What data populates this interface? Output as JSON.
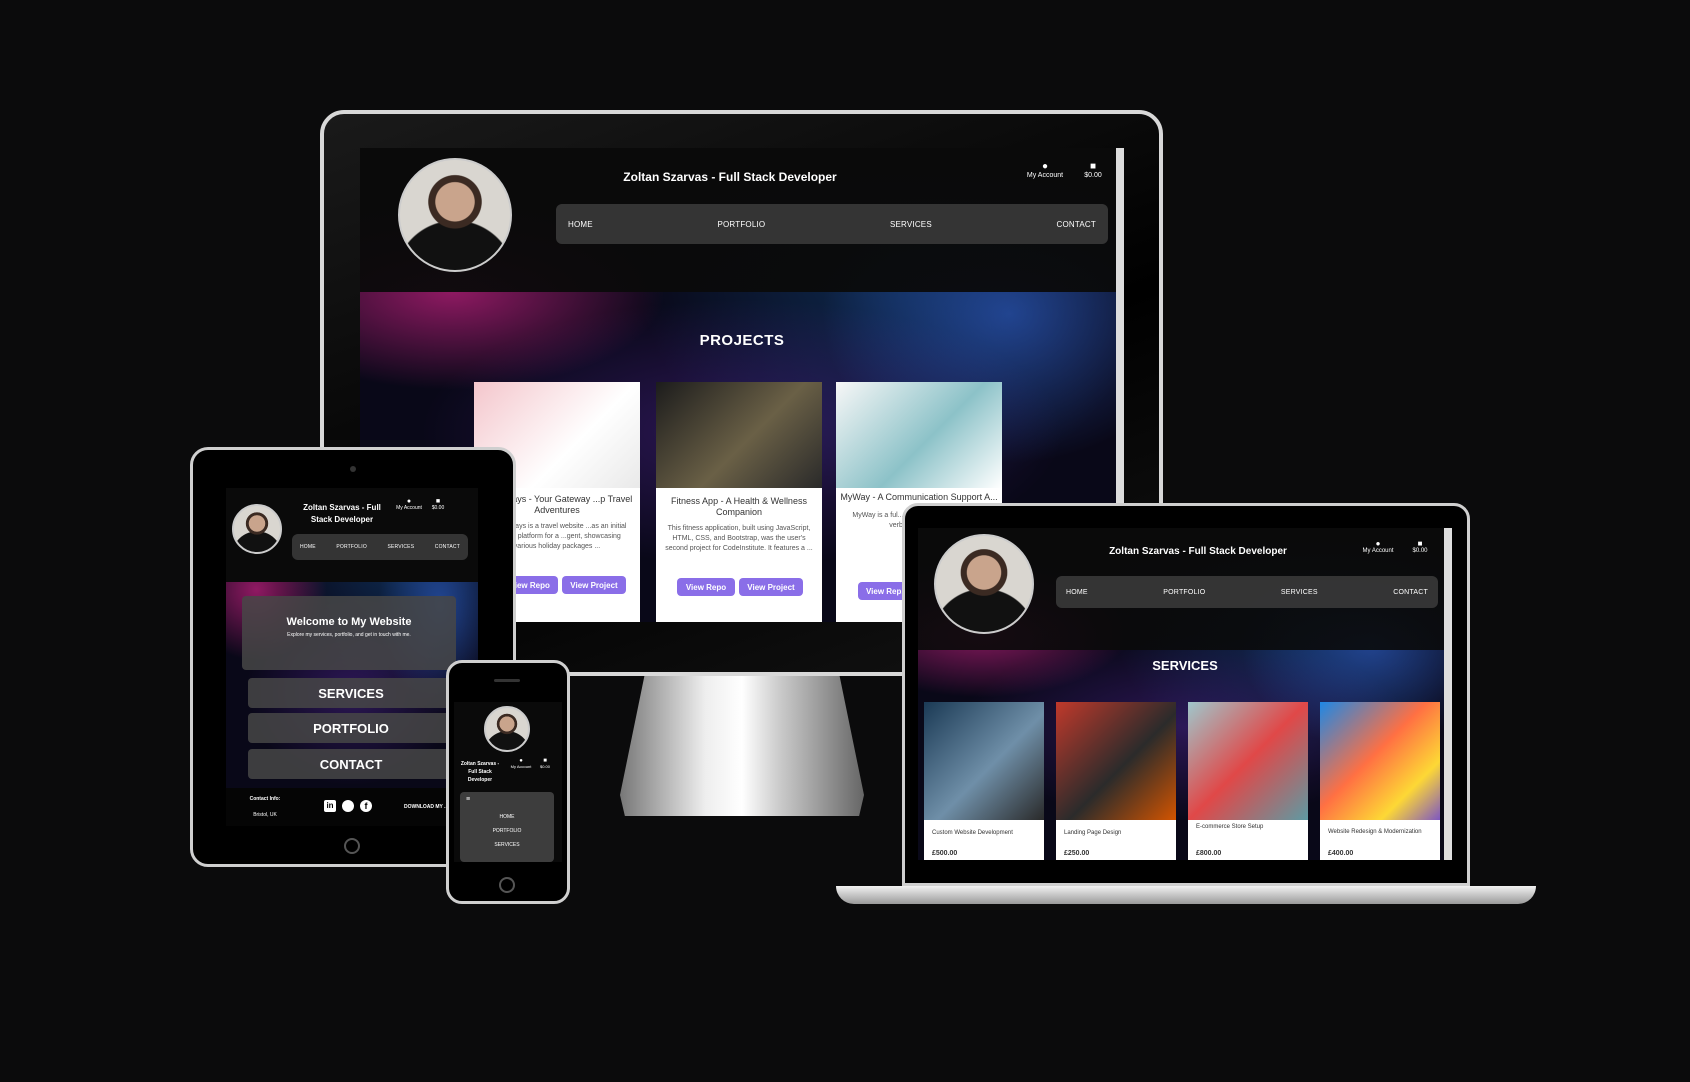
{
  "desktop": {
    "site_title": "Zoltan Szarvas - Full Stack Developer",
    "account_label": "My Account",
    "cart_total": "$0.00",
    "nav": [
      "HOME",
      "PORTFOLIO",
      "SERVICES",
      "CONTACT"
    ],
    "section_title": "PROJECTS",
    "projects": [
      {
        "title": "... Holidays - Your Gateway ...p Travel Adventures",
        "desc": "...o Holidays is a travel website ...as an initial contact platform for a ...gent, showcasing various holiday packages ...",
        "repo": "...iew Repo",
        "view": "View Project"
      },
      {
        "title": "Fitness App - A Health & Wellness Companion",
        "desc": "This fitness application, built using JavaScript, HTML, CSS, and Bootstrap, was the user's second project for CodeInstitute. It features a ...",
        "repo": "View Repo",
        "view": "View Project"
      },
      {
        "title": "MyWay - A Communication Support A...",
        "desc": "MyWay is a ful... designed to pro... for non-verbal... commun...",
        "repo": "View Rep...",
        "view": ""
      }
    ]
  },
  "tablet": {
    "site_title": "Zoltan Szarvas - Full Stack Developer",
    "account_label": "My Account",
    "cart_total": "$0.00",
    "nav": [
      "HOME",
      "PORTFOLIO",
      "SERVICES",
      "CONTACT"
    ],
    "welcome_title": "Welcome to My Website",
    "welcome_sub": "Explore my services, portfolio, and get in touch with me.",
    "menu": [
      "SERVICES",
      "PORTFOLIO",
      "CONTACT"
    ],
    "contact_label": "Contact Info:",
    "location": "Bristol, UK",
    "download": "DOWNLOAD MY ..."
  },
  "phone": {
    "site_title": "Zoltan Szarvas - Full Stack Developer",
    "account_label": "My Account",
    "cart_total": "$0.00",
    "menu": [
      "HOME",
      "PORTFOLIO",
      "SERVICES"
    ]
  },
  "laptop": {
    "site_title": "Zoltan Szarvas - Full Stack Developer",
    "account_label": "My Account",
    "cart_total": "$0.00",
    "nav": [
      "HOME",
      "PORTFOLIO",
      "SERVICES",
      "CONTACT"
    ],
    "section_title": "SERVICES",
    "services": [
      {
        "name": "Custom Website Development",
        "price": "£500.00"
      },
      {
        "name": "Landing Page Design",
        "price": "£250.00"
      },
      {
        "name": "E-commerce Store Setup",
        "price": "£800.00"
      },
      {
        "name": "Website Redesign & Modernization",
        "price": "£400.00"
      }
    ]
  },
  "colors": {
    "accent": "#8a6ee8",
    "background": "#0b0b0c",
    "nav_bg": "#3c3c3c"
  }
}
